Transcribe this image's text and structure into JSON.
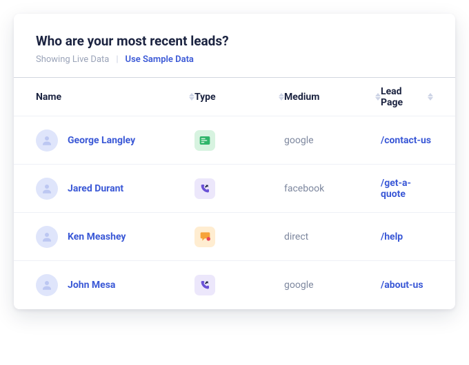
{
  "header": {
    "title": "Who are your most recent leads?",
    "showing_label": "Showing Live Data",
    "sample_link": "Use Sample Data"
  },
  "columns": {
    "name": "Name",
    "type": "Type",
    "medium": "Medium",
    "lead_page": "Lead Page"
  },
  "icons": {
    "form": "form-icon",
    "call": "call-icon",
    "chat": "chat-icon"
  },
  "leads": [
    {
      "name": "George Langley",
      "type": "form",
      "medium": "google",
      "page": "/contact-us"
    },
    {
      "name": "Jared Durant",
      "type": "call",
      "medium": "facebook",
      "page": "/get-a-quote"
    },
    {
      "name": "Ken Meashey",
      "type": "chat",
      "medium": "direct",
      "page": "/help"
    },
    {
      "name": "John Mesa",
      "type": "call",
      "medium": "google",
      "page": "/about-us"
    }
  ]
}
